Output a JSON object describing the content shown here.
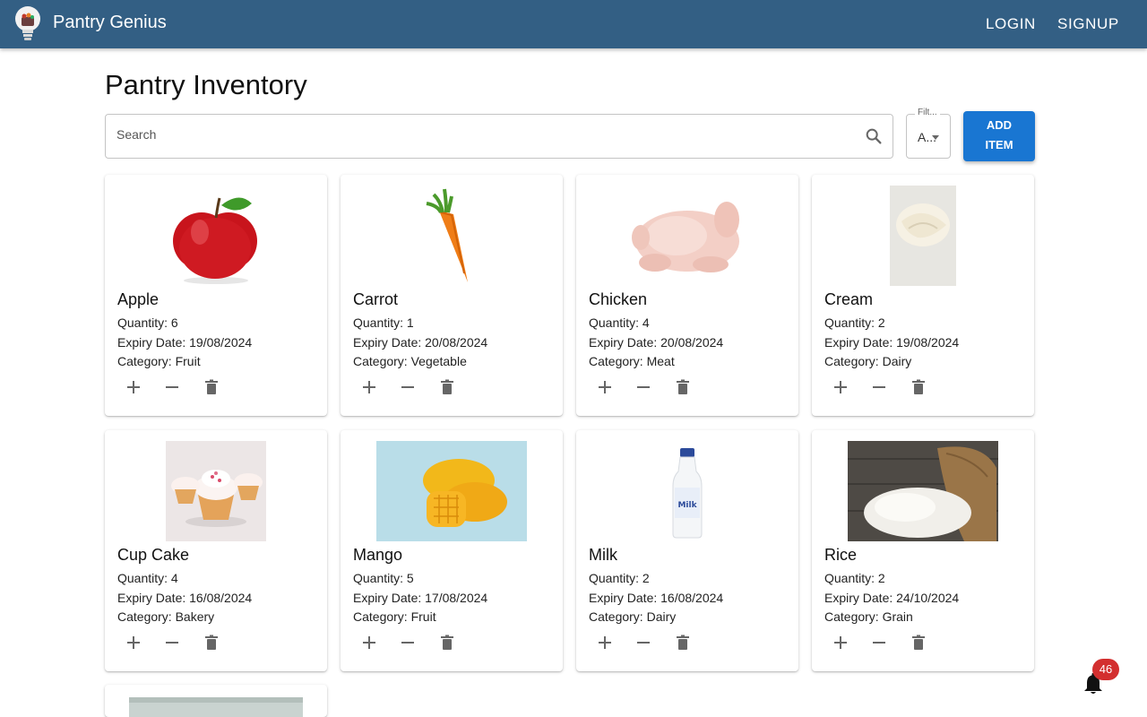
{
  "header": {
    "brand": "Pantry Genius",
    "login_label": "LOGIN",
    "signup_label": "SIGNUP",
    "logo_icon": "lightbulb-logo-icon",
    "bar_color": "#335f84"
  },
  "main": {
    "title": "Pantry Inventory",
    "search": {
      "placeholder": "Search",
      "value": "",
      "icon": "search-icon"
    },
    "filter": {
      "label": "Filt...",
      "value": "A..."
    },
    "add_button": {
      "line1": "ADD",
      "line2": "ITEM",
      "color": "#1976d2"
    }
  },
  "items": [
    {
      "name": "Apple",
      "quantity": "Quantity: 6",
      "expiry": "Expiry Date: 19/08/2024",
      "category": "Category: Fruit"
    },
    {
      "name": "Carrot",
      "quantity": "Quantity: 1",
      "expiry": "Expiry Date: 20/08/2024",
      "category": "Category: Vegetable"
    },
    {
      "name": "Chicken",
      "quantity": "Quantity: 4",
      "expiry": "Expiry Date: 20/08/2024",
      "category": "Category: Meat"
    },
    {
      "name": "Cream",
      "quantity": "Quantity: 2",
      "expiry": "Expiry Date: 19/08/2024",
      "category": "Category: Dairy"
    },
    {
      "name": "Cup Cake",
      "quantity": "Quantity: 4",
      "expiry": "Expiry Date: 16/08/2024",
      "category": "Category: Bakery"
    },
    {
      "name": "Mango",
      "quantity": "Quantity: 5",
      "expiry": "Expiry Date: 17/08/2024",
      "category": "Category: Fruit"
    },
    {
      "name": "Milk",
      "quantity": "Quantity: 2",
      "expiry": "Expiry Date: 16/08/2024",
      "category": "Category: Dairy"
    },
    {
      "name": "Rice",
      "quantity": "Quantity: 2",
      "expiry": "Expiry Date: 24/10/2024",
      "category": "Category: Grain"
    }
  ],
  "card_icons": [
    "plus-icon",
    "minus-icon",
    "delete-icon"
  ],
  "notifications": {
    "count": "46",
    "icon": "bell-icon",
    "badge_color": "#d32f2f"
  }
}
